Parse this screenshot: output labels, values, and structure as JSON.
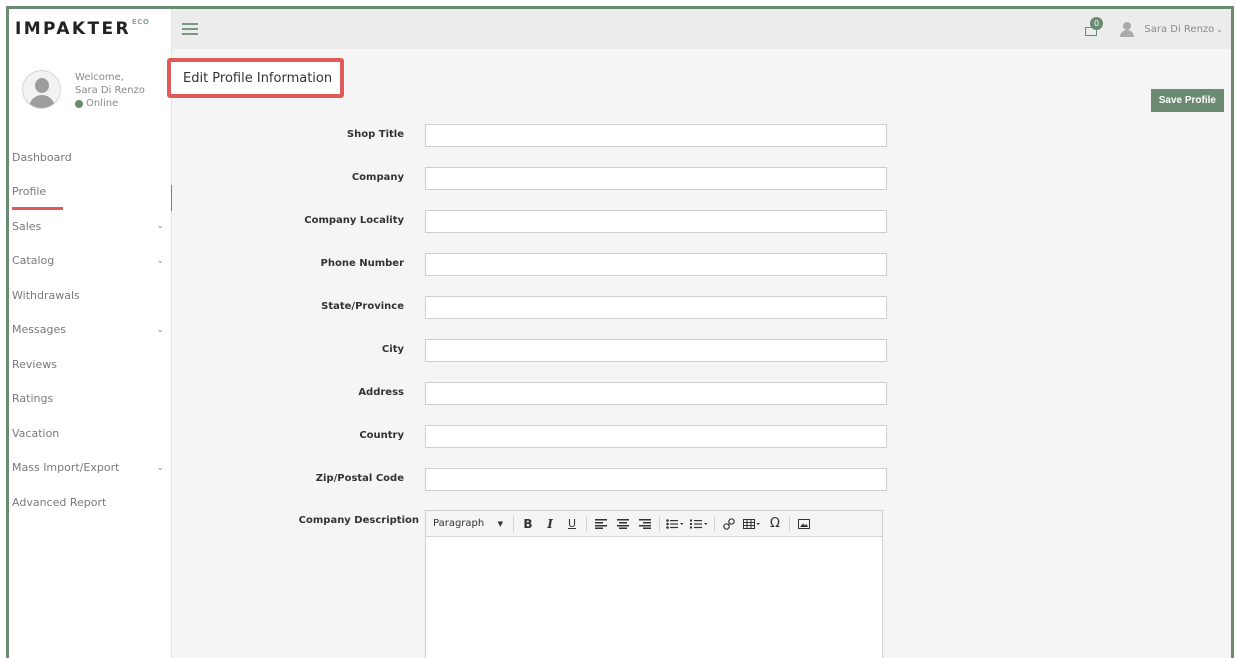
{
  "brand": {
    "name": "IMPAKTER",
    "superscript": "ECO"
  },
  "user": {
    "welcome": "Welcome,",
    "name": "Sara Di Renzo",
    "status": "Online",
    "menu_name": "Sara Di Renzo",
    "notification_count": "0"
  },
  "sidebar": {
    "items": [
      {
        "label": "Dashboard",
        "has_chevron": false
      },
      {
        "label": "Profile",
        "has_chevron": false,
        "active": true
      },
      {
        "label": "Sales",
        "has_chevron": true
      },
      {
        "label": "Catalog",
        "has_chevron": true
      },
      {
        "label": "Withdrawals",
        "has_chevron": false
      },
      {
        "label": "Messages",
        "has_chevron": true
      },
      {
        "label": "Reviews",
        "has_chevron": false
      },
      {
        "label": "Ratings",
        "has_chevron": false
      },
      {
        "label": "Vacation",
        "has_chevron": false
      },
      {
        "label": "Mass Import/Export",
        "has_chevron": true
      },
      {
        "label": "Advanced Report",
        "has_chevron": false
      }
    ]
  },
  "page": {
    "title": "Edit Profile Information",
    "save_label": "Save Profile"
  },
  "form": {
    "fields": [
      {
        "label": "Shop Title",
        "value": ""
      },
      {
        "label": "Company",
        "value": ""
      },
      {
        "label": "Company Locality",
        "value": ""
      },
      {
        "label": "Phone Number",
        "value": ""
      },
      {
        "label": "State/Province",
        "value": ""
      },
      {
        "label": "City",
        "value": ""
      },
      {
        "label": "Address",
        "value": ""
      },
      {
        "label": "Country",
        "value": ""
      },
      {
        "label": "Zip/Postal Code",
        "value": ""
      }
    ],
    "description_label": "Company Description",
    "editor": {
      "format_label": "Paragraph"
    }
  },
  "colors": {
    "accent": "#6b8a72",
    "highlight": "#e05a5a"
  }
}
